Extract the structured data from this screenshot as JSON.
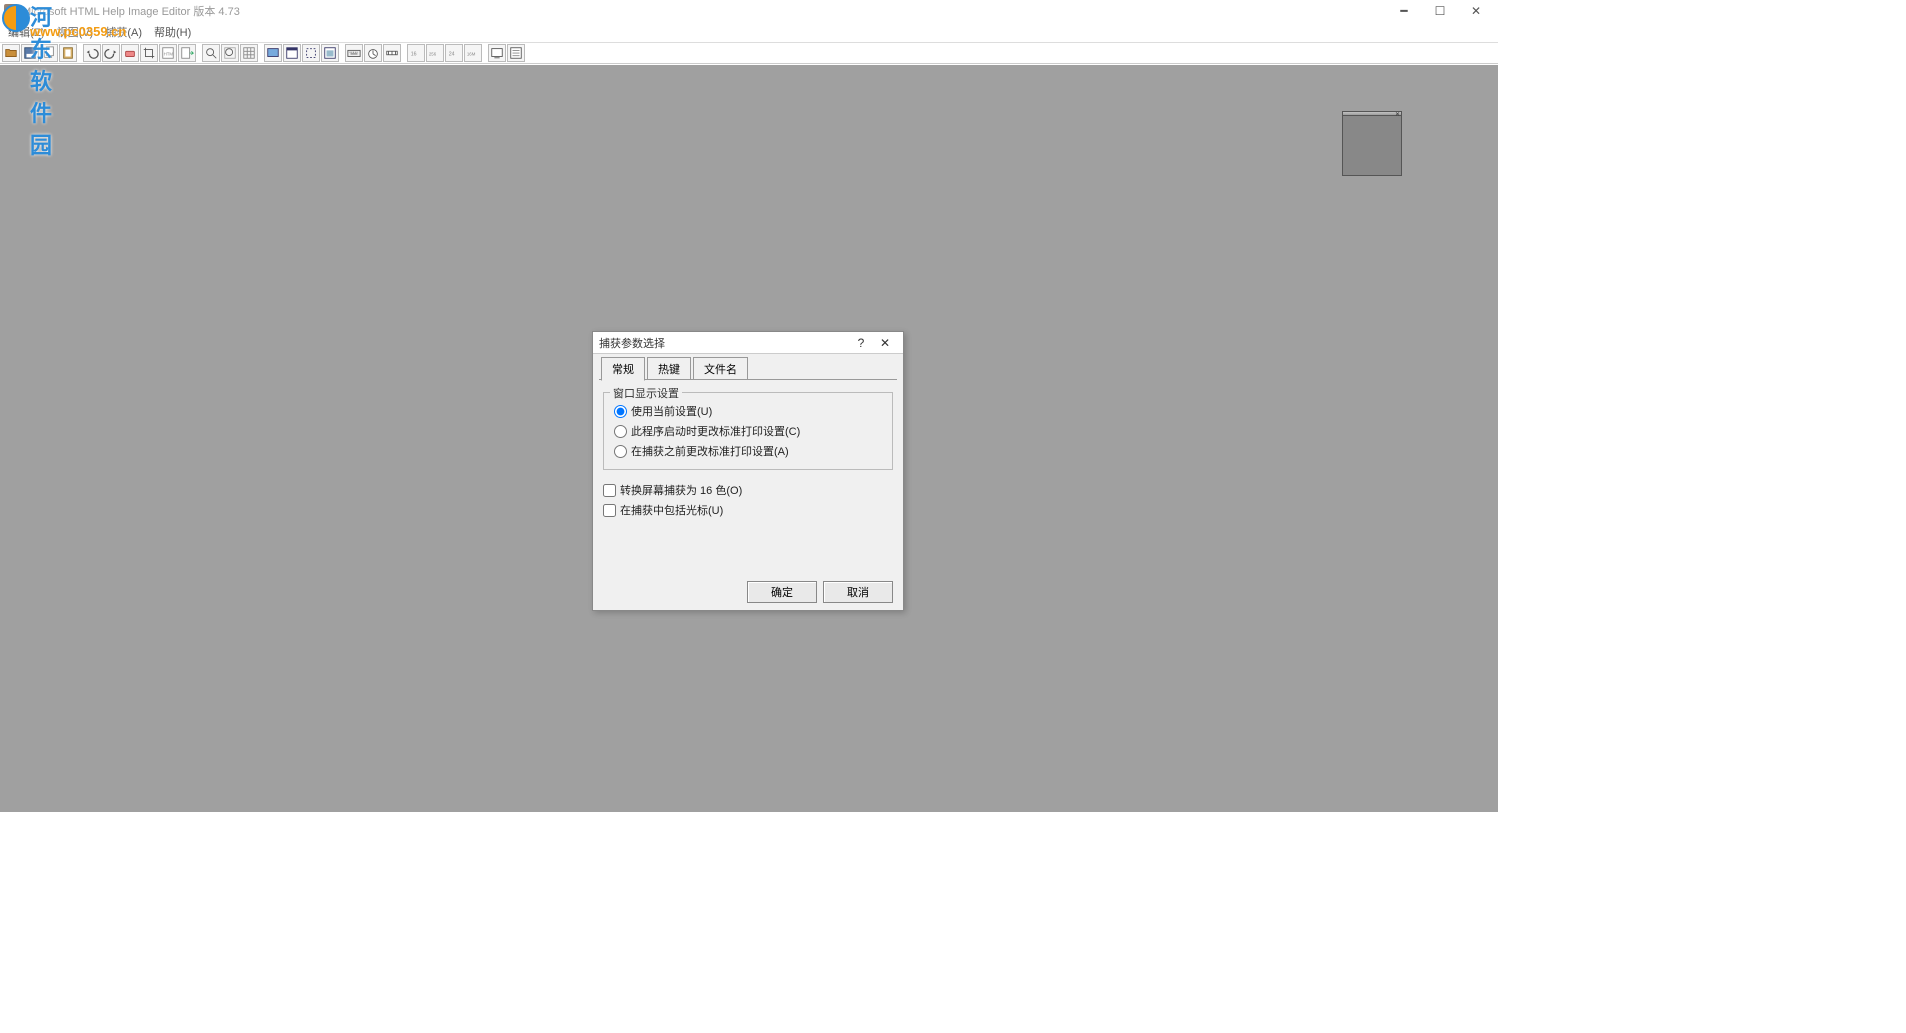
{
  "window": {
    "title": "Microsoft HTML Help Image Editor 版本 4.73"
  },
  "menubar": {
    "items": [
      "编辑(E)",
      "视图(V)",
      "捕获(A)",
      "帮助(H)"
    ]
  },
  "dialog": {
    "title": "捕获参数选择",
    "tabs": [
      "常规",
      "热键",
      "文件名"
    ],
    "group_legend": "窗口显示设置",
    "radios": {
      "r1": "使用当前设置(U)",
      "r2": "此程序启动时更改标准打印设置(C)",
      "r3": "在捕获之前更改标准打印设置(A)"
    },
    "checks": {
      "c1": "转换屏幕捕获为 16 色(O)",
      "c2": "在捕获中包括光标(U)"
    },
    "ok": "确定",
    "cancel": "取消"
  },
  "watermark": {
    "big": "河东软件园",
    "small": "www.pc0359.cn"
  }
}
